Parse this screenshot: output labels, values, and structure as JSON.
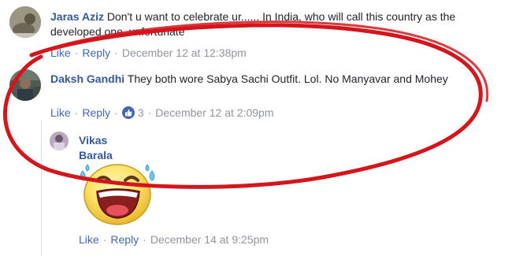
{
  "comments": [
    {
      "author": "Jaras Aziz",
      "text": "Don't u want to celebrate ur...... In India, who will call this country as the developed one, unfortunate",
      "like_label": "Like",
      "reply_label": "Reply",
      "timestamp": "December 12 at 12:38pm"
    },
    {
      "author": "Daksh Gandhi",
      "text": "They both wore Sabya Sachi Outfit. Lol. No Manyavar and Mohey",
      "like_label": "Like",
      "reply_label": "Reply",
      "reaction_count": "3",
      "timestamp": "December 12 at 2:09pm"
    }
  ],
  "reply": {
    "author": "Vikas Barala",
    "sticker": "laughing-tears-emoji",
    "like_label": "Like",
    "reply_label": "Reply",
    "timestamp": "December 14 at 9:25pm"
  },
  "colors": {
    "name_link": "#365899",
    "action_link": "#4267b2",
    "meta_gray": "#90949c",
    "annotation_oval": "#d4161c"
  }
}
